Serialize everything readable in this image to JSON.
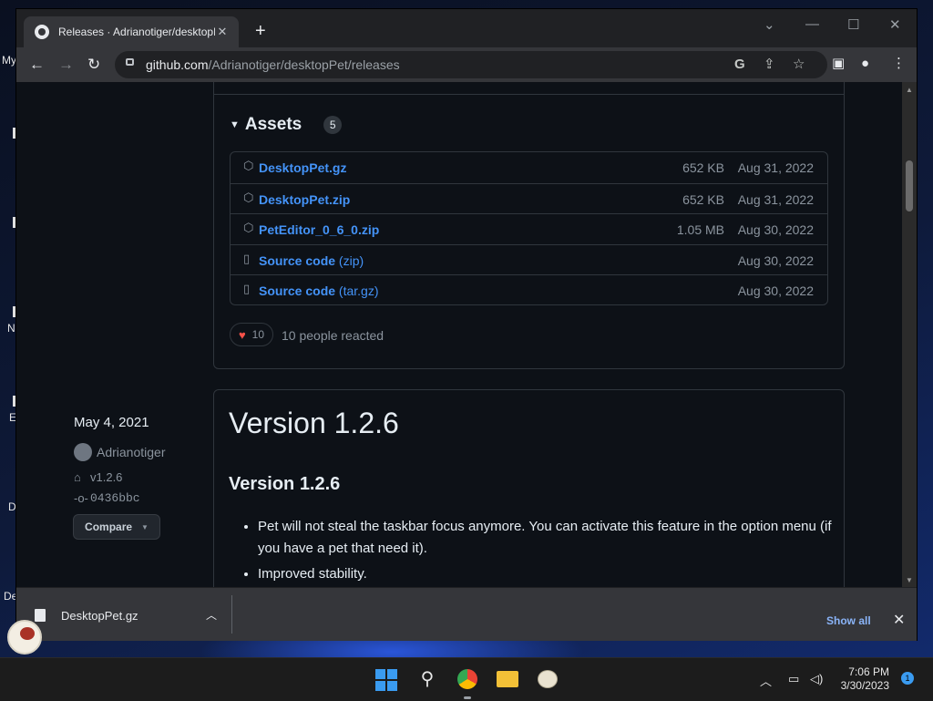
{
  "browser": {
    "tab_title": "Releases · Adrianotiger/desktopP",
    "url_host": "github.com",
    "url_path": "/Adrianotiger/desktopPet/releases"
  },
  "assets": {
    "heading": "Assets",
    "count": "5",
    "rows": [
      {
        "name": "DesktopPet.gz",
        "ext": "",
        "size": "652 KB",
        "date": "Aug 31, 2022",
        "icon": "package-icon"
      },
      {
        "name": "DesktopPet.zip",
        "ext": "",
        "size": "652 KB",
        "date": "Aug 31, 2022",
        "icon": "package-icon"
      },
      {
        "name": "PetEditor_0_6_0.zip",
        "ext": "",
        "size": "1.05 MB",
        "date": "Aug 30, 2022",
        "icon": "package-icon"
      },
      {
        "name": "Source code",
        "ext": "(zip)",
        "size": "",
        "date": "Aug 30, 2022",
        "icon": "file-zip-icon"
      },
      {
        "name": "Source code",
        "ext": "(tar.gz)",
        "size": "",
        "date": "Aug 30, 2022",
        "icon": "file-zip-icon"
      }
    ]
  },
  "reactions": {
    "count": "10",
    "text": "10 people reacted"
  },
  "release": {
    "date": "May 4, 2021",
    "author": "Adrianotiger",
    "tag": "v1.2.6",
    "commit": "0436bbc",
    "compare_label": "Compare",
    "title": "Version 1.2.6",
    "subtitle": "Version 1.2.6",
    "notes": [
      "Pet will not steal the taskbar focus anymore. You can activate this feature in the option menu (if you have a pet that need it).",
      "Improved stability."
    ]
  },
  "download_bar": {
    "file": "DesktopPet.gz",
    "show_all": "Show all"
  },
  "taskbar": {
    "time": "7:06 PM",
    "date": "3/30/2023",
    "notifications": "1"
  },
  "desktop_labels": [
    "My",
    "N",
    "E",
    "D",
    "De"
  ],
  "colors": {
    "link": "#4493f8",
    "muted": "#8b949e",
    "page_bg": "#0d1117",
    "border": "#30363d"
  }
}
